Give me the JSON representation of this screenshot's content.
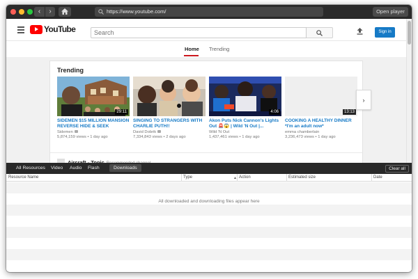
{
  "browser": {
    "url": "https://www.youtube.com/",
    "open_player_label": "Open player"
  },
  "youtube": {
    "logo_text": "YouTube",
    "search_placeholder": "Search",
    "signin_label": "Sign in",
    "tabs": [
      {
        "label": "Home",
        "active": true
      },
      {
        "label": "Trending",
        "active": false
      }
    ],
    "section_title": "Trending",
    "videos": [
      {
        "title": "SIDEMEN $15 MILLION MANSION REVERSE HIDE & SEEK",
        "channel": "Sidemen",
        "views": "5,874,159 views",
        "age": "1 day ago",
        "duration": "29:11"
      },
      {
        "title": "SINGING TO STRANGERS WITH CHARLIE PUTH!!",
        "channel": "David Dobrik",
        "views": "7,334,843 views",
        "age": "2 days ago",
        "duration": ""
      },
      {
        "title": "Akon Puts Nick Cannon's Lights Out 🚨😱 | Wild 'N Out |...",
        "channel": "Wild 'N Out",
        "views": "1,437,461 views",
        "age": "1 day ago",
        "duration": "4:06"
      },
      {
        "title": "COOKING A HEALTHY DINNER *I'm an adult now*",
        "channel": "emma chamberlain",
        "views": "3,236,473 views",
        "age": "1 day ago",
        "duration": "13:13"
      }
    ],
    "recommended_channel": {
      "name": "Aircraft - Topic",
      "subtitle": "Recommended channel"
    },
    "meta_separator": "•"
  },
  "resources_panel": {
    "tabs": [
      "All Resources",
      "Video",
      "Audio",
      "Flash",
      "Downloads"
    ],
    "active_tab": "Downloads",
    "clear_all_label": "Clear all",
    "columns": [
      "Resource Name",
      "Type",
      "Action",
      "Estimated size",
      "Date"
    ],
    "empty_message": "All downloaded and downloading files appear here"
  },
  "colors": {
    "accent_blue": "#167ac6",
    "youtube_red": "#ff0000",
    "panel_dark": "#292929"
  }
}
